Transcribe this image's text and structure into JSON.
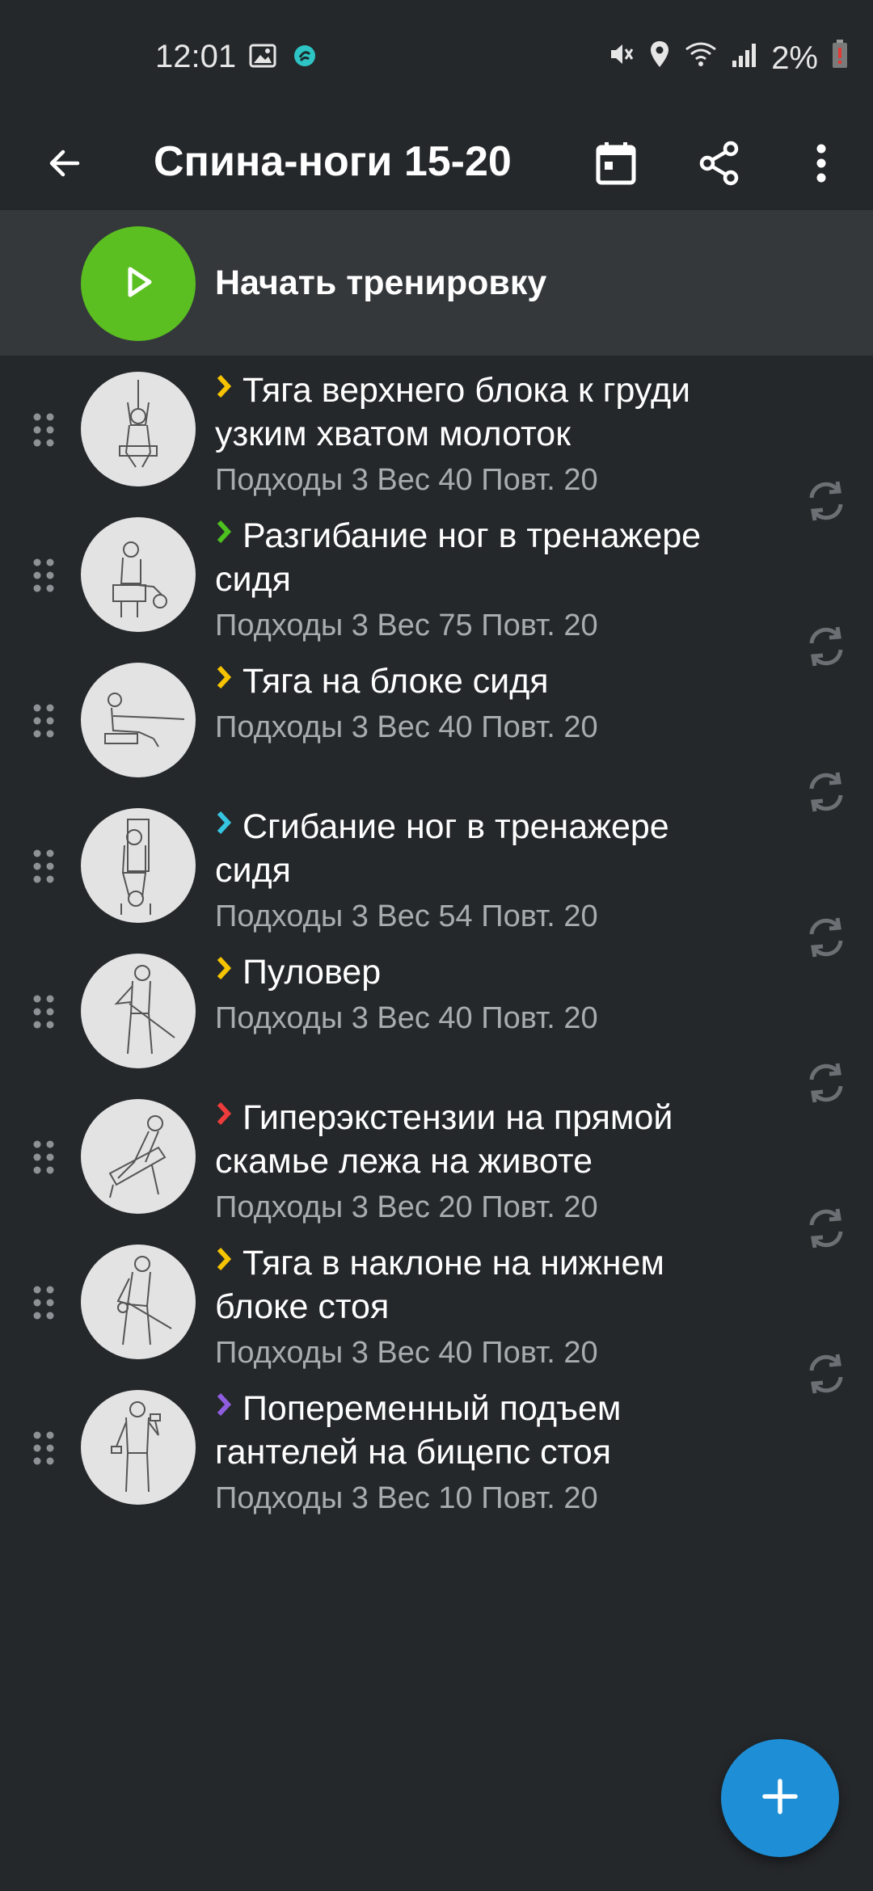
{
  "status_bar": {
    "time": "12:01",
    "battery": "2%",
    "icons": [
      "image-icon",
      "app-notification-icon",
      "mute-icon",
      "location-icon",
      "wifi-icon",
      "signal-icon",
      "battery-low-icon"
    ]
  },
  "app_bar": {
    "title": "Спина-ноги 15-20",
    "icons": [
      "back-arrow-icon",
      "calendar-icon",
      "share-icon",
      "more-vert-icon"
    ]
  },
  "start": {
    "label": "Начать тренировку",
    "color": "#5bbf21"
  },
  "exercises": [
    {
      "line1": "Тяга верхнего блока к груди",
      "line2": "узким хватом молоток",
      "meta": "Подходы 3 Вес 40 Повт. 20",
      "chevron_color": "#f5c300"
    },
    {
      "line1": "Разгибание ног в тренажере",
      "line2": "сидя",
      "meta": "Подходы 3 Вес 75 Повт. 20",
      "chevron_color": "#4cc11f"
    },
    {
      "line1": "Тяга на блоке сидя",
      "line2": "",
      "meta": "Подходы 3 Вес 40 Повт. 20",
      "chevron_color": "#f5c300"
    },
    {
      "line1": "Сгибание ног в тренажере",
      "line2": "сидя",
      "meta": "Подходы 3 Вес 54 Повт. 20",
      "chevron_color": "#35c5e0"
    },
    {
      "line1": "Пуловер",
      "line2": "",
      "meta": "Подходы 3 Вес 40 Повт. 20",
      "chevron_color": "#f5c300"
    },
    {
      "line1": "Гиперэкстензии на прямой",
      "line2": "скамье лежа на животе",
      "meta": "Подходы 3 Вес 20 Повт. 20",
      "chevron_color": "#ee3b3b"
    },
    {
      "line1": "Тяга в наклоне на нижнем",
      "line2": "блоке стоя",
      "meta": "Подходы 3 Вес 40 Повт. 20",
      "chevron_color": "#f5c300"
    },
    {
      "line1": "Попеременный подъем",
      "line2": "гантелей на бицепс стоя",
      "meta": "Подходы 3 Вес 10 Повт. 20",
      "chevron_color": "#8f5de0"
    }
  ],
  "fab": {
    "icon": "plus-icon",
    "color": "#1e8fd6"
  }
}
